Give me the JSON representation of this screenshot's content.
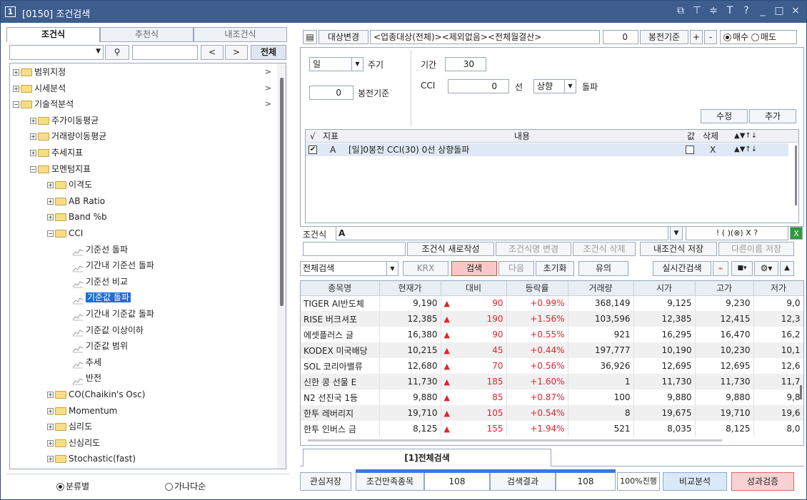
{
  "window": {
    "num": "1",
    "title": "[0150] 조건검색"
  },
  "left": {
    "tabs": [
      "조건식",
      "추천식",
      "내조건식"
    ],
    "search_prev": "<",
    "search_next": ">",
    "search_all": "전체",
    "tree": [
      {
        "label": "범위지정",
        "level": 0,
        "type": "folder",
        "pm": "+",
        "arrow": ">"
      },
      {
        "label": "시세분석",
        "level": 0,
        "type": "folder",
        "pm": "+",
        "arrow": ">"
      },
      {
        "label": "기술적분석",
        "level": 0,
        "type": "folder",
        "pm": "-",
        "arrow": ">"
      },
      {
        "label": "주가이동평균",
        "level": 1,
        "type": "folder",
        "pm": "+"
      },
      {
        "label": "거래량이동평균",
        "level": 1,
        "type": "folder",
        "pm": "+"
      },
      {
        "label": "추세지표",
        "level": 1,
        "type": "folder",
        "pm": "+"
      },
      {
        "label": "모멘텀지표",
        "level": 1,
        "type": "folder",
        "pm": "-"
      },
      {
        "label": "이격도",
        "level": 2,
        "type": "folder",
        "pm": "+"
      },
      {
        "label": "AB Ratio",
        "level": 2,
        "type": "folder",
        "pm": "+"
      },
      {
        "label": "Band %b",
        "level": 2,
        "type": "folder",
        "pm": "+"
      },
      {
        "label": "CCI",
        "level": 2,
        "type": "folder",
        "pm": "-"
      },
      {
        "label": "기준선 돌파",
        "level": 3,
        "type": "chart"
      },
      {
        "label": "기간내 기준선 돌파",
        "level": 3,
        "type": "chart"
      },
      {
        "label": "기준선 비교",
        "level": 3,
        "type": "chart"
      },
      {
        "label": "기준값 돌파",
        "level": 3,
        "type": "chart",
        "selected": true
      },
      {
        "label": "기간내 기준값 돌파",
        "level": 3,
        "type": "chart"
      },
      {
        "label": "기준값 이상이하",
        "level": 3,
        "type": "chart"
      },
      {
        "label": "기준값 범위",
        "level": 3,
        "type": "chart"
      },
      {
        "label": "추세",
        "level": 3,
        "type": "chart"
      },
      {
        "label": "반전",
        "level": 3,
        "type": "chart"
      },
      {
        "label": "CO(Chaikin's Osc)",
        "level": 2,
        "type": "folder",
        "pm": "+"
      },
      {
        "label": "Momentum",
        "level": 2,
        "type": "folder",
        "pm": "+"
      },
      {
        "label": "심리도",
        "level": 2,
        "type": "folder",
        "pm": "+"
      },
      {
        "label": "신심리도",
        "level": 2,
        "type": "folder",
        "pm": "+"
      },
      {
        "label": "Stochastic(fast)",
        "level": 2,
        "type": "folder",
        "pm": "+"
      }
    ],
    "radio_category": "분류별",
    "radio_alpha": "가나다순"
  },
  "right": {
    "target_change": "대상변경",
    "target_text": "<업종대상(전체)><제외없음><전체월결산>",
    "bong_value": "0",
    "bong_label": "봉전기준",
    "plus": "+",
    "minus": "-",
    "buy": "매수",
    "sell": "매도",
    "period_select": "일",
    "period_label": "주기",
    "bong2_value": "0",
    "bong2_label": "봉전기준",
    "gigan_label": "기간",
    "gigan_value": "30",
    "cci_label": "CCI",
    "cci_value": "0",
    "line_label": "선",
    "dir_select": "상향",
    "dolpa": "돌파",
    "modify": "수정",
    "add": "추가",
    "grid_headers": {
      "check": "√",
      "indicator": "지표",
      "content": "내용",
      "val": "값",
      "del": "삭제"
    },
    "grid_row": {
      "indicator": "A",
      "content": "[일]0봉전 CCI(30) 0선 상향돌파",
      "del": "X"
    },
    "cond_label": "조건식",
    "cond_value": "A",
    "cond_btns": [
      "!",
      "(",
      ")",
      "(⊗)",
      "X",
      "?"
    ],
    "new_cond": "조건식 새로작성",
    "rename": "조건식명 변경",
    "delete": "조건식 삭제",
    "save": "내조건식 저장",
    "save_as": "다른이름 저장",
    "search_scope": "전체검색",
    "krx": "KRX",
    "search": "검색",
    "next": "다음",
    "reset": "초기화",
    "note": "유의",
    "realtime": "실시간검색",
    "columns": [
      "종목명",
      "현재가",
      "대비",
      "등락률",
      "거래량",
      "시가",
      "고가",
      "저가"
    ],
    "rows": [
      [
        "TIGER AI반도체",
        "9,190",
        "90",
        "+0.99%",
        "368,149",
        "9,125",
        "9,230",
        "9,0"
      ],
      [
        "RISE 버크셔포",
        "12,385",
        "190",
        "+1.56%",
        "103,596",
        "12,385",
        "12,415",
        "12,3"
      ],
      [
        "에셋플러스 글",
        "16,380",
        "90",
        "+0.55%",
        "921",
        "16,295",
        "16,470",
        "16,2"
      ],
      [
        "KODEX 미국배당",
        "10,215",
        "45",
        "+0.44%",
        "197,777",
        "10,190",
        "10,230",
        "10,1"
      ],
      [
        "SOL 코리아밸류",
        "12,680",
        "70",
        "+0.56%",
        "36,926",
        "12,695",
        "12,695",
        "12,6"
      ],
      [
        "신한 콩 선물 E",
        "11,730",
        "185",
        "+1.60%",
        "1",
        "11,730",
        "11,730",
        "11,7"
      ],
      [
        "N2 선진국 1등",
        "9,880",
        "85",
        "+0.87%",
        "100",
        "9,880",
        "9,880",
        "9,8"
      ],
      [
        "한투 레버리지",
        "19,710",
        "105",
        "+0.54%",
        "8",
        "19,675",
        "19,710",
        "19,6"
      ],
      [
        "한투 인버스 금",
        "8,125",
        "155",
        "+1.94%",
        "521",
        "8,035",
        "8,125",
        "8,0"
      ]
    ],
    "result_tab": "[1]전체검색",
    "fav_save": "관심저장",
    "satisfy_label": "조건만족종목",
    "satisfy_count": "108",
    "result_label": "검색결과",
    "result_count": "108",
    "progress_text": "100%진행",
    "progress": 1.0,
    "compare": "비교분석",
    "verify": "성과검증"
  },
  "colors": {
    "title": "#3d5d8f",
    "selected": "#1a6ed8",
    "up": "#e0242f",
    "search_btn": "#f8c8c8"
  }
}
